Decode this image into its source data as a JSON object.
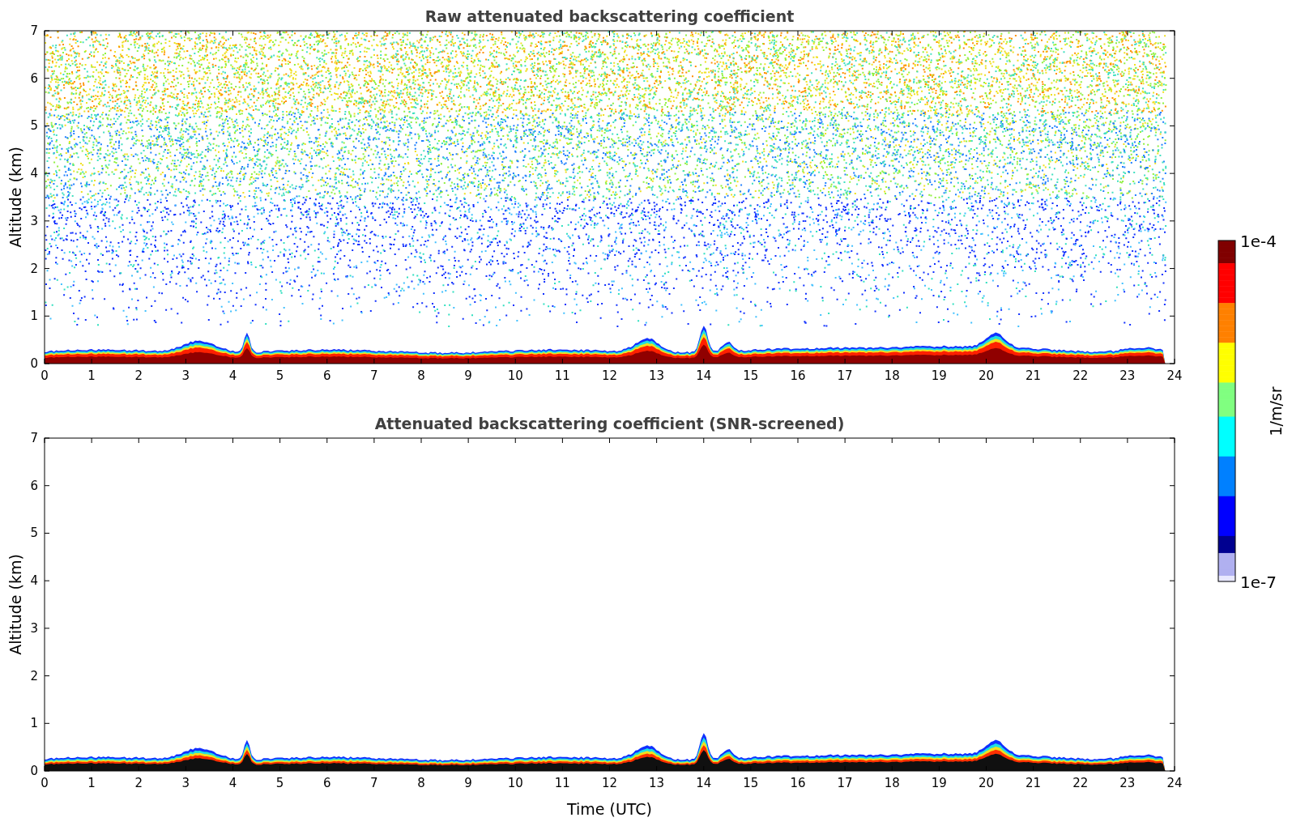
{
  "figure": {
    "xlabel": "Time (UTC)"
  },
  "panels": [
    {
      "kind": "raw",
      "title": "Raw attenuated backscattering coefficient",
      "ylabel": "Altitude (km)",
      "yticks": [
        "7",
        "6",
        "5",
        "4",
        "3",
        "2",
        "1",
        "0"
      ],
      "xticks": [
        "0",
        "1",
        "2",
        "3",
        "4",
        "5",
        "6",
        "7",
        "8",
        "9",
        "10",
        "11",
        "12",
        "13",
        "14",
        "15",
        "16",
        "17",
        "18",
        "19",
        "20",
        "21",
        "22",
        "23",
        "24"
      ]
    },
    {
      "kind": "screened",
      "title": "Attenuated backscattering coefficient (SNR-screened)",
      "ylabel": "Altitude (km)",
      "yticks": [
        "7",
        "6",
        "5",
        "4",
        "3",
        "2",
        "1",
        "0"
      ],
      "xticks": [
        "0",
        "1",
        "2",
        "3",
        "4",
        "5",
        "6",
        "7",
        "8",
        "9",
        "10",
        "11",
        "12",
        "13",
        "14",
        "15",
        "16",
        "17",
        "18",
        "19",
        "20",
        "21",
        "22",
        "23",
        "24"
      ]
    }
  ],
  "colorbar": {
    "top_label": "1e-4",
    "bottom_label": "1e-7",
    "label": "1/m/sr"
  }
}
